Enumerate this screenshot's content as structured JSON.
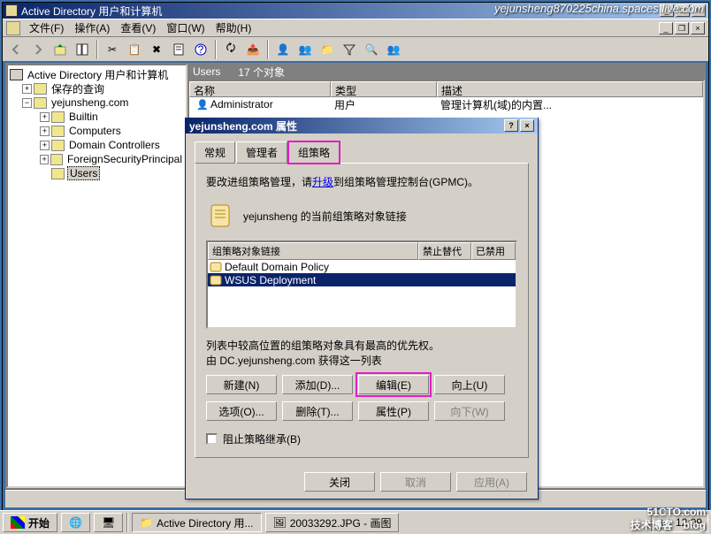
{
  "watermark": "yejunsheng870225china.spaces.live.com",
  "watermark2": {
    "main": "51CTO.com",
    "sub": "技术博客　blog"
  },
  "window": {
    "title": "Active Directory 用户和计算机",
    "menus": [
      "文件(F)",
      "操作(A)",
      "查看(V)",
      "窗口(W)",
      "帮助(H)"
    ]
  },
  "tree": {
    "root": "Active Directory 用户和计算机",
    "saved_queries": "保存的查询",
    "domain": "yejunsheng.com",
    "children": [
      "Builtin",
      "Computers",
      "Domain Controllers",
      "ForeignSecurityPrincipal",
      "Users"
    ]
  },
  "right": {
    "header_name": "Users",
    "header_count": "17 个对象",
    "cols": {
      "name": "名称",
      "type": "类型",
      "desc": "描述"
    },
    "row": {
      "name": "Administrator",
      "type": "用户",
      "desc": "管理计算机(域)的内置..."
    }
  },
  "dialog": {
    "title": "yejunsheng.com 属性",
    "tabs": {
      "general": "常规",
      "managed": "管理者",
      "gpo": "组策略"
    },
    "upgrade_pre": "要改进组策略管理，请",
    "upgrade_link": "升级",
    "upgrade_post": "到组策略管理控制台(GPMC)。",
    "current_links": "yejunsheng 的当前组策略对象链接",
    "cols": {
      "link": "组策略对象链接",
      "nooverride": "禁止替代",
      "disabled": "已禁用"
    },
    "items": [
      "Default Domain Policy",
      "WSUS Deployment"
    ],
    "priority_note": "列表中较高位置的组策略对象具有最高的优先权。",
    "obtained": "由 DC.yejunsheng.com 获得这一列表",
    "buttons": {
      "new": "新建(N)",
      "add": "添加(D)...",
      "edit": "编辑(E)",
      "up": "向上(U)",
      "options": "选项(O)...",
      "delete": "删除(T)...",
      "properties": "属性(P)",
      "down": "向下(W)"
    },
    "block": "阻止策略继承(B)",
    "footer": {
      "close": "关闭",
      "cancel": "取消",
      "apply": "应用(A)"
    }
  },
  "taskbar": {
    "start": "开始",
    "task1": "Active Directory 用...",
    "task2": "20033292.JPG - 画图",
    "time": "12:09"
  }
}
